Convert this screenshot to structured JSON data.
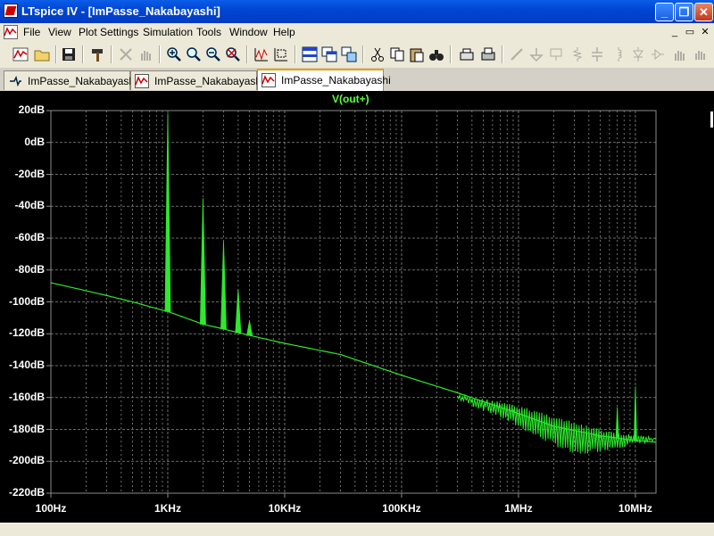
{
  "window": {
    "title": "LTspice IV - [ImPasse_Nakabayashi]",
    "minimize_glyph": "_",
    "restore_glyph": "❐",
    "close_glyph": "✕"
  },
  "menu": {
    "items": [
      "File",
      "View",
      "Plot Settings",
      "Simulation",
      "Tools",
      "Window",
      "Help"
    ],
    "mdi_minimize": "_",
    "mdi_restore": "▭",
    "mdi_close": "✕"
  },
  "toolbar": {
    "buttons": [
      "waveform-icon",
      "open-folder-icon",
      "save-icon",
      "hammer-icon",
      "scissors-run-icon",
      "hand-pan-icon",
      "zoom-in-icon",
      "zoom-area-icon",
      "zoom-out-icon",
      "zoom-fit-icon",
      "autoscale-icon",
      "tile-icon",
      "cascade-icon",
      "arrange-icon",
      "cut-icon",
      "copy-icon",
      "paste-icon",
      "find-icon",
      "print-preview-icon",
      "print-icon",
      "wire-icon",
      "ground-icon",
      "label-icon",
      "resistor-icon",
      "capacitor-icon",
      "inductor-icon",
      "diode-icon",
      "component-icon",
      "move-hand-icon",
      "drag-icon"
    ]
  },
  "tabs": [
    {
      "label": "ImPasse_Nakabayashi",
      "icon": "schematic-icon",
      "active": false
    },
    {
      "label": "ImPasse_Nakabayashi",
      "icon": "waveform-icon",
      "active": false
    },
    {
      "label": "ImPasse_Nakabayashi",
      "icon": "waveform-icon",
      "active": true
    }
  ],
  "chart_data": {
    "type": "line",
    "title": "V(out+)",
    "xlabel": "",
    "ylabel": "",
    "x_scale": "log",
    "x_range_hz": [
      100,
      15000000
    ],
    "y_range_db": [
      -220,
      20
    ],
    "grid": true,
    "x_tick_labels": [
      "100Hz",
      "1KHz",
      "10KHz",
      "100KHz",
      "1MHz",
      "10MHz"
    ],
    "x_tick_values": [
      100,
      1000,
      10000,
      100000,
      1000000,
      10000000
    ],
    "y_tick_labels": [
      "20dB",
      "0dB",
      "-20dB",
      "-40dB",
      "-60dB",
      "-80dB",
      "-100dB",
      "-120dB",
      "-140dB",
      "-160dB",
      "-180dB",
      "-200dB",
      "-220dB"
    ],
    "y_tick_values": [
      20,
      0,
      -20,
      -40,
      -60,
      -80,
      -100,
      -120,
      -140,
      -160,
      -180,
      -200,
      -220
    ],
    "series": [
      {
        "name": "V(out+)",
        "color": "#2fe82f",
        "baseline": [
          [
            100,
            -88
          ],
          [
            200,
            -93
          ],
          [
            300,
            -96
          ],
          [
            500,
            -100
          ],
          [
            700,
            -103
          ],
          [
            1000,
            -106
          ],
          [
            2000,
            -114
          ],
          [
            3000,
            -117
          ],
          [
            5000,
            -121
          ],
          [
            10000,
            -126
          ],
          [
            30000,
            -133
          ],
          [
            100000,
            -146
          ],
          [
            300000,
            -157
          ],
          [
            1000000,
            -170
          ],
          [
            2000000,
            -178
          ],
          [
            5000000,
            -184
          ],
          [
            10000000,
            -187
          ],
          [
            15000000,
            -188
          ]
        ],
        "peaks": [
          [
            1000,
            18
          ],
          [
            2000,
            -35
          ],
          [
            3000,
            -62
          ],
          [
            4000,
            -92
          ],
          [
            5000,
            -112
          ],
          [
            7000000,
            -166
          ],
          [
            10000000,
            -153
          ]
        ],
        "noise_band": {
          "x_start": 300000,
          "x_end": 15000000,
          "upper_db": [
            -158,
            -162,
            -168,
            -176,
            -182,
            -185
          ],
          "lower_db": [
            -162,
            -172,
            -185,
            -197,
            -192,
            -188
          ]
        }
      }
    ]
  },
  "colors": {
    "background": "#000000",
    "grid": "#8a8a8a",
    "trace": "#2fe82f",
    "axis_text": "#ffffff",
    "title_text": "#5cff3a",
    "active_tab_accent": "#e8a000"
  }
}
